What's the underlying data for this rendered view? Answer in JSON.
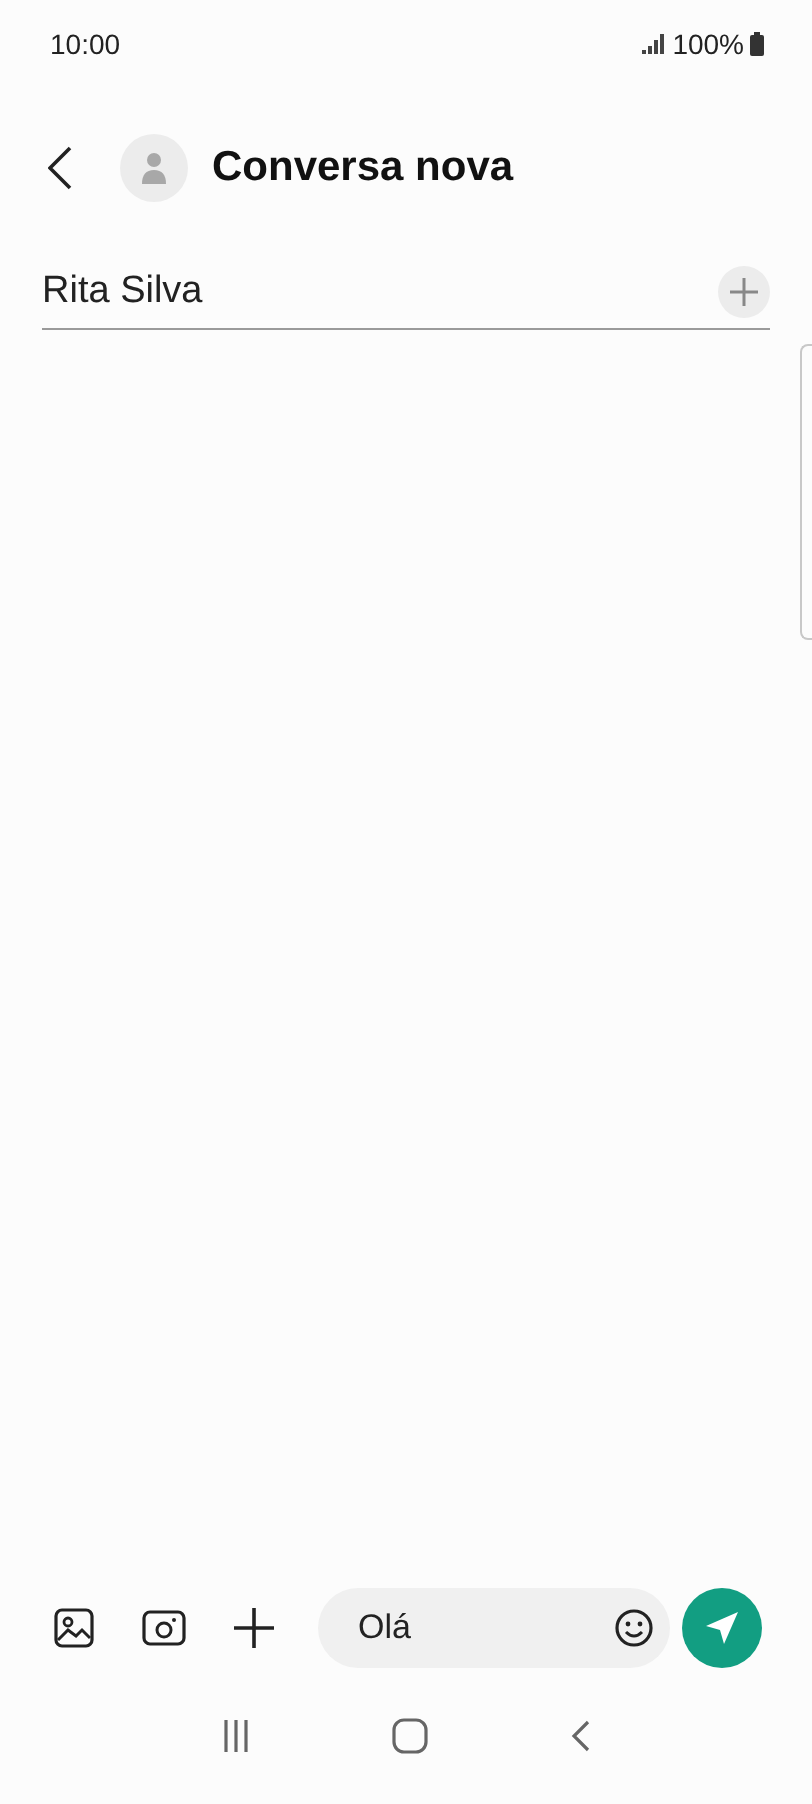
{
  "status_bar": {
    "time": "10:00",
    "battery": "100%"
  },
  "header": {
    "title": "Conversa nova"
  },
  "recipient": {
    "value": "Rita Silva"
  },
  "composer": {
    "value": "Olá"
  }
}
